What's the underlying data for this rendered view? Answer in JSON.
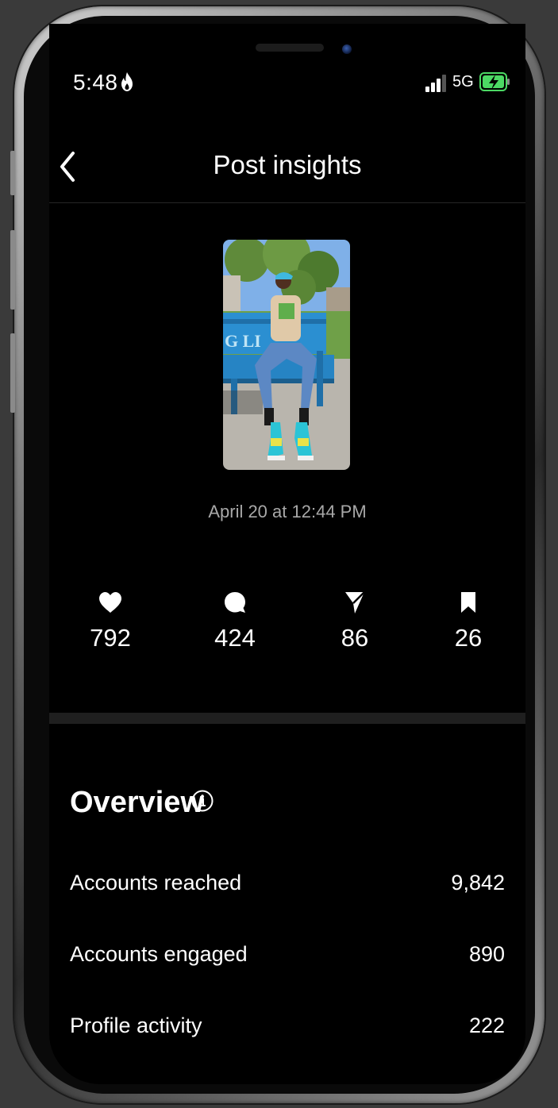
{
  "status_bar": {
    "time": "5:48",
    "network": "5G"
  },
  "header": {
    "title": "Post insights"
  },
  "post": {
    "date": "April 20 at 12:44 PM",
    "thumbnail_icon": "post-photo-thumbnail"
  },
  "stats": [
    {
      "icon": "heart-icon",
      "value": "792"
    },
    {
      "icon": "comment-icon",
      "value": "424"
    },
    {
      "icon": "share-icon",
      "value": "86"
    },
    {
      "icon": "bookmark-icon",
      "value": "26"
    }
  ],
  "overview": {
    "title": "Overview",
    "metrics": [
      {
        "label": "Accounts reached",
        "value": "9,842"
      },
      {
        "label": "Accounts engaged",
        "value": "890"
      },
      {
        "label": "Profile activity",
        "value": "222"
      }
    ]
  },
  "colors": {
    "background": "#000000",
    "text": "#ffffff",
    "muted": "#a8a8a8",
    "divider": "#1f1f1f",
    "battery_charging": "#4cd964"
  }
}
